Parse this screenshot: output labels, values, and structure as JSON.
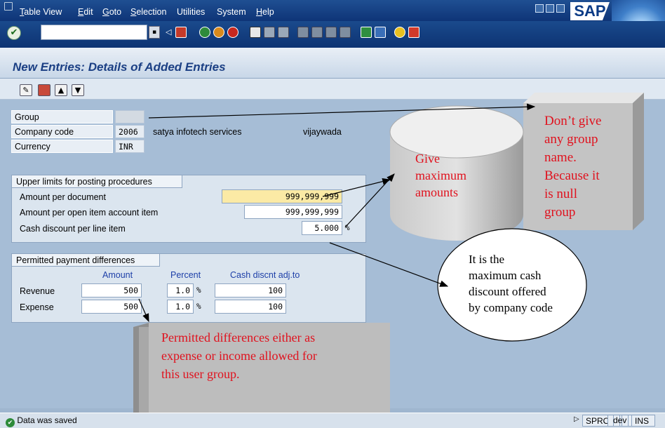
{
  "menubar": {
    "items": [
      {
        "u": "T",
        "rest": "able View"
      },
      {
        "u": "E",
        "rest": "dit"
      },
      {
        "u": "G",
        "rest": "oto"
      },
      {
        "u": "S",
        "rest": "election"
      },
      {
        "u": "",
        "rest": "Utilities"
      },
      {
        "u": "",
        "rest": "System"
      },
      {
        "u": "H",
        "rest": "elp"
      }
    ],
    "logo": "SAP"
  },
  "toolbar": {
    "command_value": "",
    "enter_icon": "✔"
  },
  "page": {
    "title": "New Entries: Details of Added Entries"
  },
  "header": {
    "group_label": "Group",
    "group_value": "",
    "company_label": "Company code",
    "company_value": "2006",
    "company_name": "satya infotech services",
    "company_city": "vijaywada",
    "currency_label": "Currency",
    "currency_value": "INR"
  },
  "upper_limits": {
    "title": "Upper limits for posting procedures",
    "amount_doc_label": "Amount per document",
    "amount_doc_value": "999,999,999",
    "amount_open_label": "Amount per open item account item",
    "amount_open_value": "999,999,999",
    "cash_disc_label": "Cash discount per line item",
    "cash_disc_value": "5.000",
    "cash_disc_unit": "%"
  },
  "payment_diff": {
    "title": "Permitted payment differences",
    "col_amount": "Amount",
    "col_percent": "Percent",
    "col_cash": "Cash discnt adj.to",
    "rows": [
      {
        "label": "Revenue",
        "amount": "500",
        "percent": "1.0",
        "pct_unit": "%",
        "cash": "100"
      },
      {
        "label": "Expense",
        "amount": "500",
        "percent": "1.0",
        "pct_unit": "%",
        "cash": "100"
      }
    ]
  },
  "annotations": {
    "group_note": [
      "Don’t give",
      "any group",
      "name.",
      "Because it",
      "is null",
      "group"
    ],
    "max_note": [
      "Give",
      "maximum",
      "amounts"
    ],
    "cash_note": [
      "It is the",
      "maximum cash",
      "discount offered",
      "by company code"
    ],
    "diff_note": [
      "Permitted differences either as",
      "expense or income allowed for",
      "this user group."
    ]
  },
  "status": {
    "message": "Data was saved",
    "transaction": "SPRO",
    "system": "dev",
    "mode": "INS"
  },
  "colors": {
    "note_red": "#e0121e",
    "title_blue": "#1b3f84",
    "col_blue": "#1d3fa8"
  }
}
